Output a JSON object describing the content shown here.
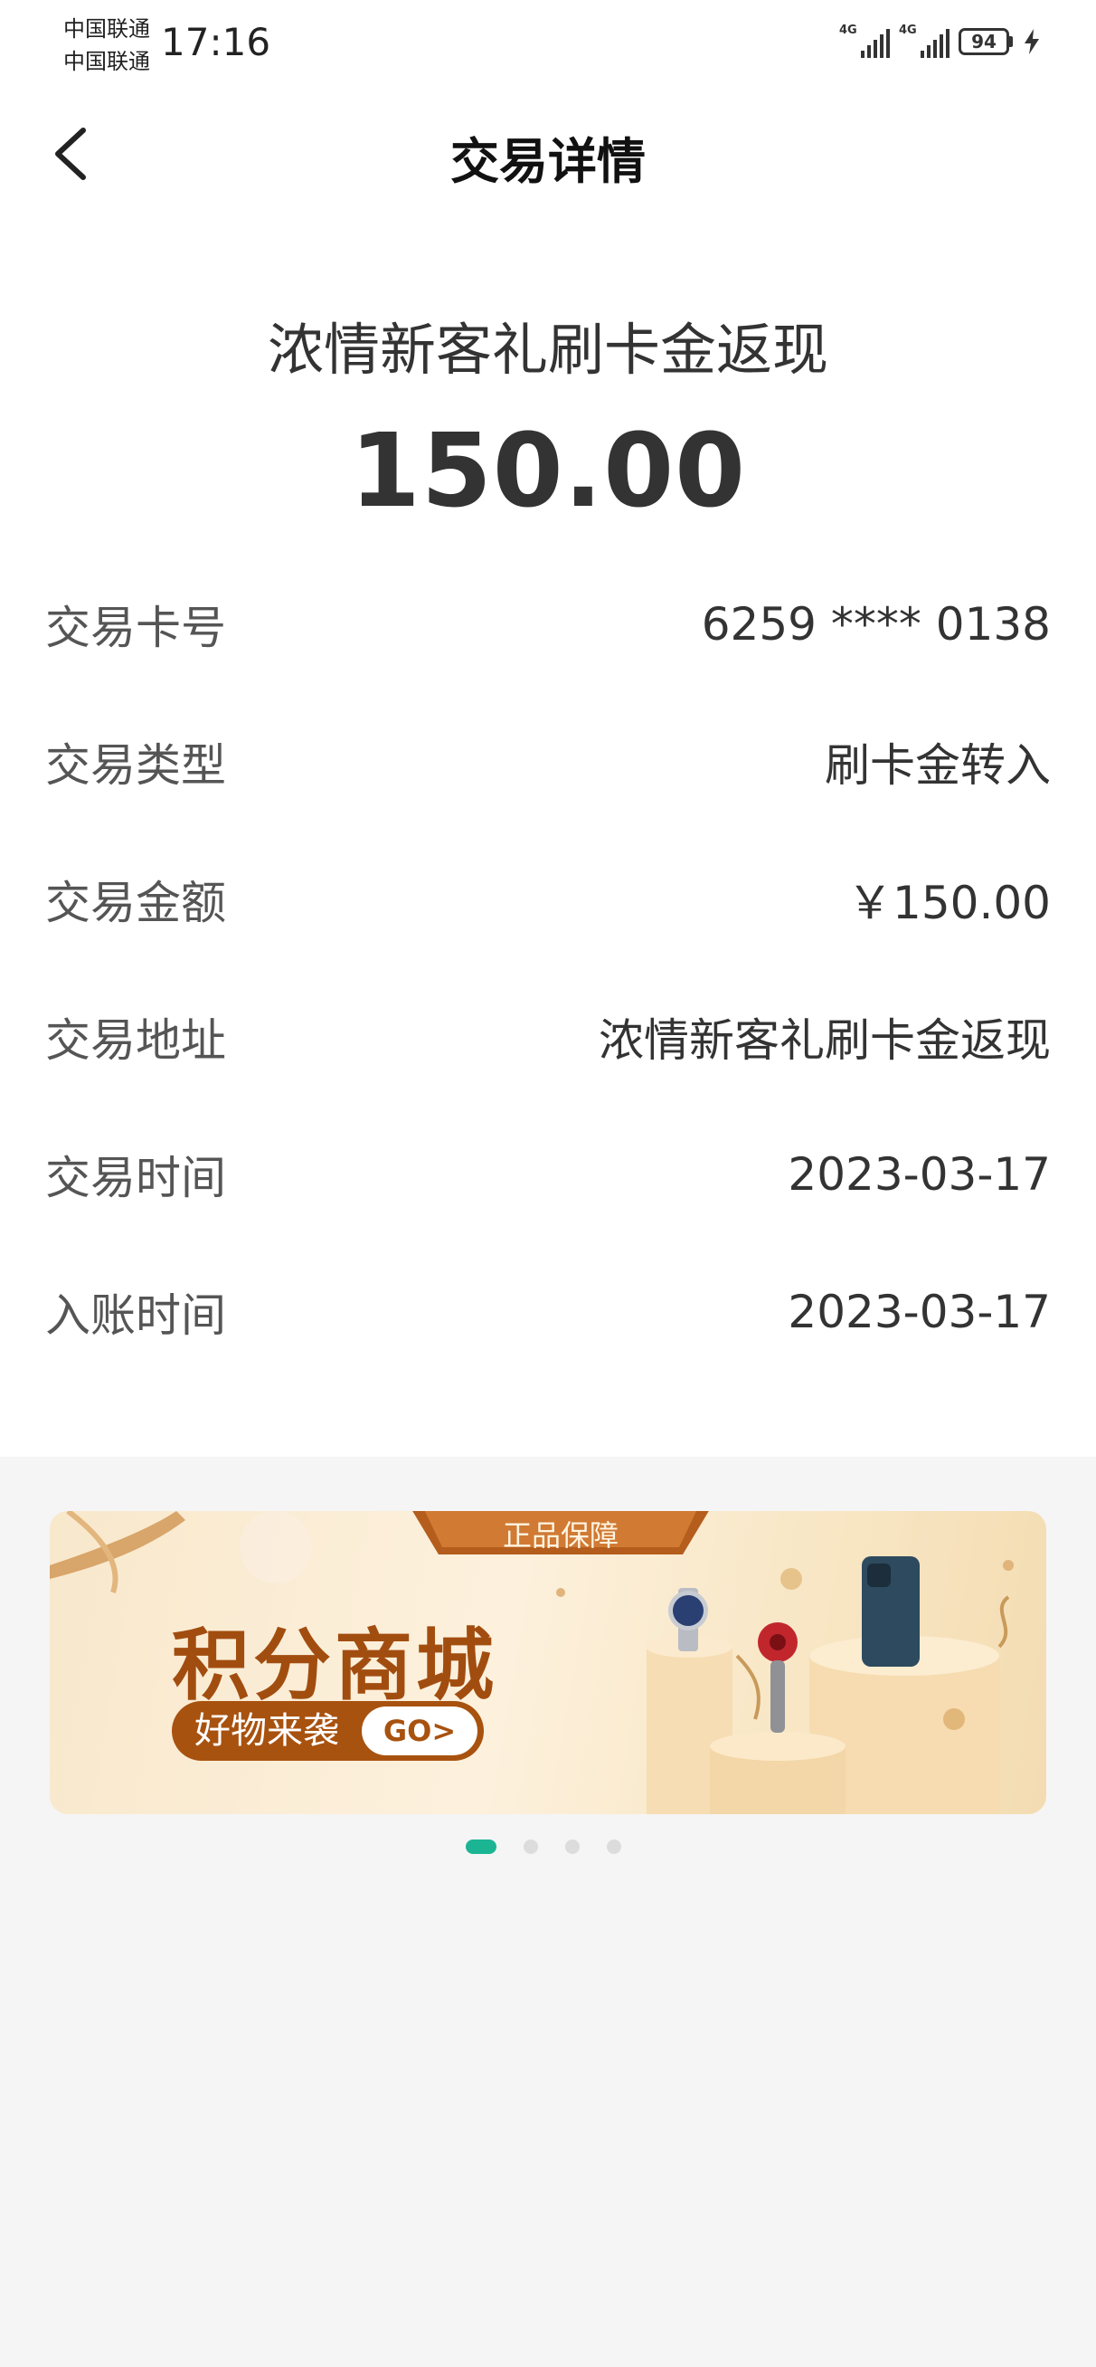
{
  "status_bar": {
    "carrier_1": "中国联通",
    "carrier_2": "中国联通",
    "time": "17:16",
    "network_1": "4G",
    "network_2": "4G",
    "battery": "94"
  },
  "header": {
    "title": "交易详情"
  },
  "summary": {
    "title": "浓情新客礼刷卡金返现",
    "amount": "150.00"
  },
  "details": [
    {
      "label": "交易卡号",
      "value": "6259 **** 0138"
    },
    {
      "label": "交易类型",
      "value": "刷卡金转入"
    },
    {
      "label": "交易金额",
      "value": "￥150.00"
    },
    {
      "label": "交易地址",
      "value": "浓情新客礼刷卡金返现"
    },
    {
      "label": "交易时间",
      "value": "2023-03-17"
    },
    {
      "label": "入账时间",
      "value": "2023-03-17"
    }
  ],
  "banner": {
    "ribbon": "正品保障",
    "title": "积分商城",
    "slogan": "好物来袭",
    "cta": "GO>"
  },
  "pager": {
    "count": 4,
    "active_index": 0
  },
  "colors": {
    "accent": "#1bb594",
    "banner_brown": "#a8520f"
  }
}
